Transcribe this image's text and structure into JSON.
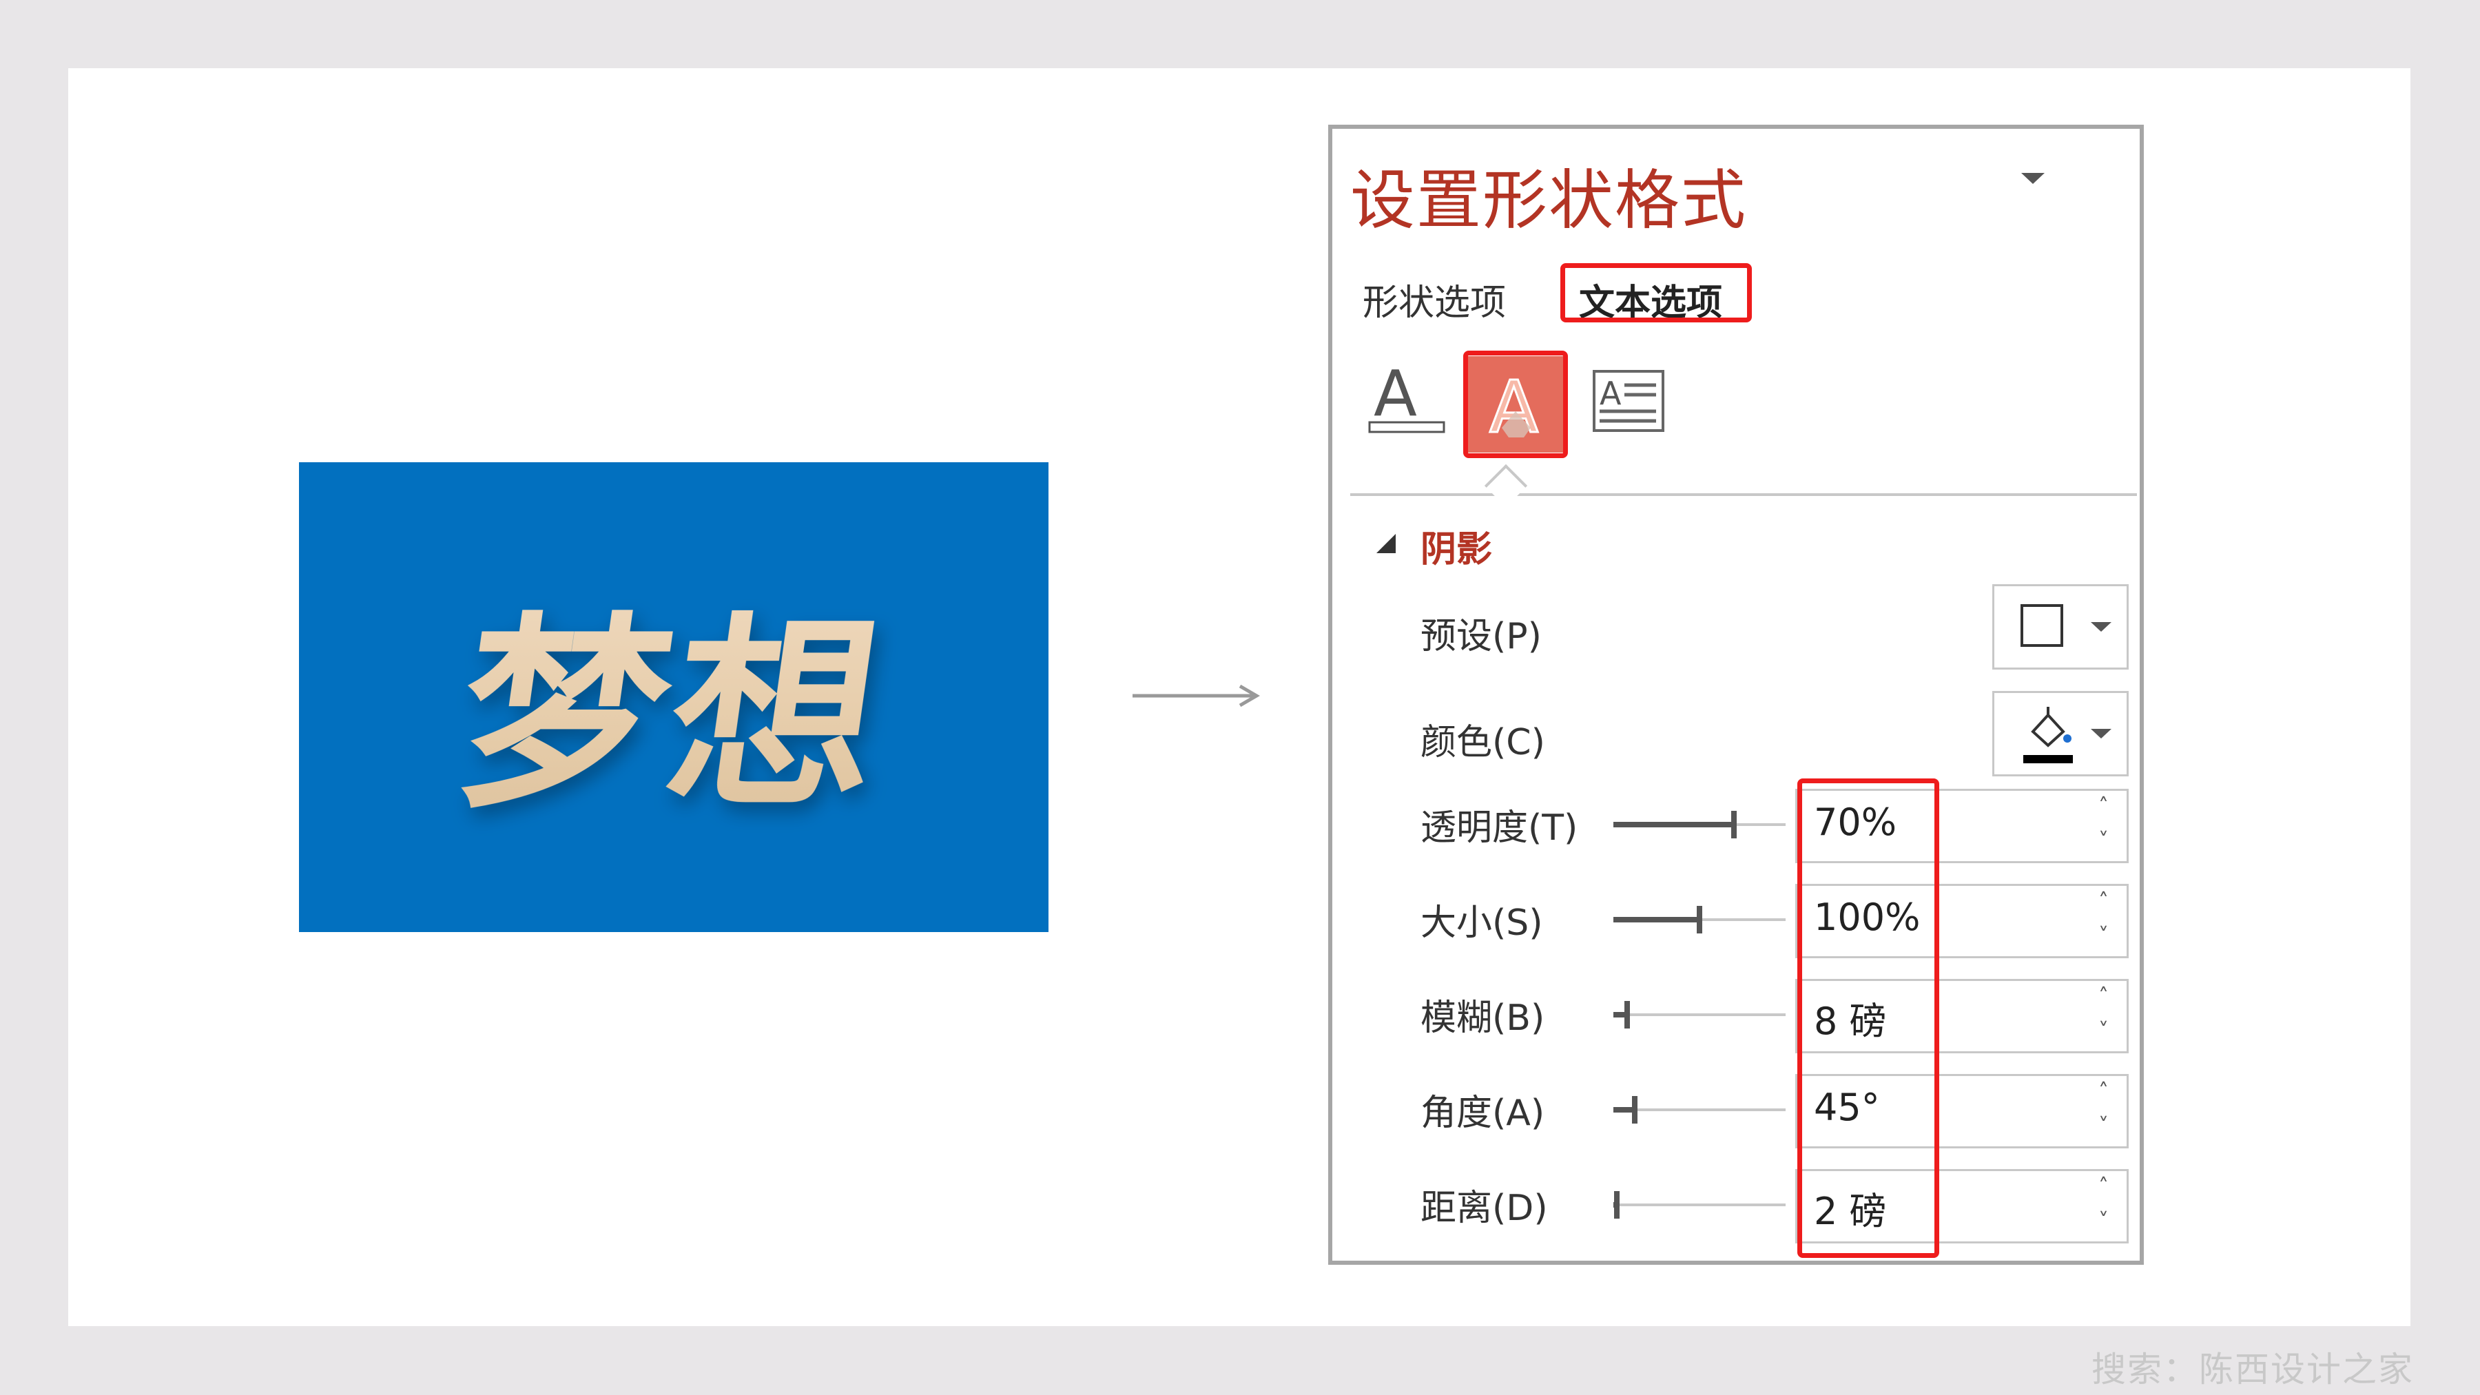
{
  "preview": {
    "text": "梦想",
    "background": "#0270bf"
  },
  "panel": {
    "title": "设置形状格式",
    "tabs": {
      "shape_options": "形状选项",
      "text_options": "文本选项"
    },
    "icon_buttons": [
      "text-fill-outline-icon",
      "text-effects-icon",
      "textbox-icon"
    ],
    "section": {
      "title": "阴影",
      "preset_label": "预设(P)",
      "color_label": "颜色(C)",
      "rows": [
        {
          "label": "透明度(T)",
          "value": "70%",
          "slider": 0.7
        },
        {
          "label": "大小(S)",
          "value": "100%",
          "slider": 0.5
        },
        {
          "label": "模糊(B)",
          "value": "8 磅",
          "slider": 0.08
        },
        {
          "label": "角度(A)",
          "value": "45°",
          "slider": 0.125
        },
        {
          "label": "距离(D)",
          "value": "2 磅",
          "slider": 0.02
        }
      ]
    }
  },
  "colors": {
    "accent_red": "#b33424",
    "highlight": "#ee1c1c"
  },
  "footer": "搜索：陈西设计之家"
}
